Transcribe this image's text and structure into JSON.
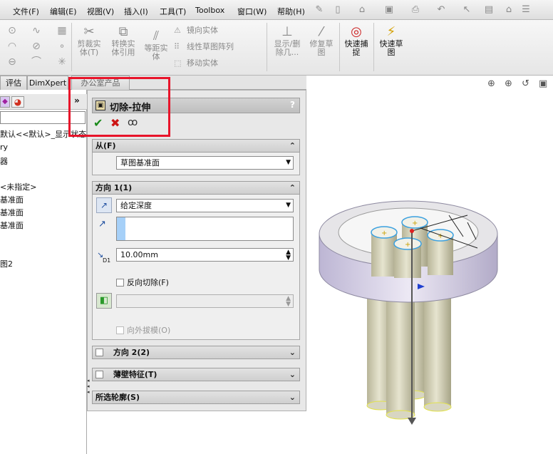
{
  "menu": {
    "items": [
      "文件(F)",
      "编辑(E)",
      "视图(V)",
      "插入(I)",
      "工具(T)",
      "Toolbox",
      "窗口(W)",
      "帮助(H)"
    ]
  },
  "command_manager": {
    "trim": "剪裁实\n体(T)",
    "convert": "转换实\n体引用",
    "offset": "等距实\n体",
    "mirror": "镜向实体",
    "linear_pattern": "线性草图阵列",
    "move": "移动实体",
    "show_delete": "显示/删\n除几...",
    "repair": "修复草\n图",
    "quick_snap": "快速捕\n捉",
    "rapid_sketch": "快速草\n图"
  },
  "tabs": {
    "evaluate": "评估",
    "dimxpert": "DimXpert",
    "office": "办公室产品"
  },
  "tree": {
    "lines": [
      "默认<<默认>_显示状态",
      "ry",
      "器",
      "<未指定>",
      "基准面",
      "基准面",
      "基准面",
      "图2"
    ]
  },
  "property_manager": {
    "title": "切除-拉伸",
    "help": "?",
    "from": {
      "header": "从(F)",
      "value": "草图基准面"
    },
    "direction1": {
      "header": "方向 1(1)",
      "end_condition": "给定深度",
      "depth_label": "D1",
      "depth": "10.00mm",
      "flip": "反向切除(F)",
      "draft": "向外拔模(O)"
    },
    "direction2": {
      "header": "方向 2(2)"
    },
    "thin": {
      "header": "薄壁特征(T)"
    },
    "contours": {
      "header": "所选轮廓(S)"
    }
  },
  "colors": {
    "highlight": "#e8142a",
    "ok": "#1a8a1a",
    "cancel": "#cc1414"
  }
}
